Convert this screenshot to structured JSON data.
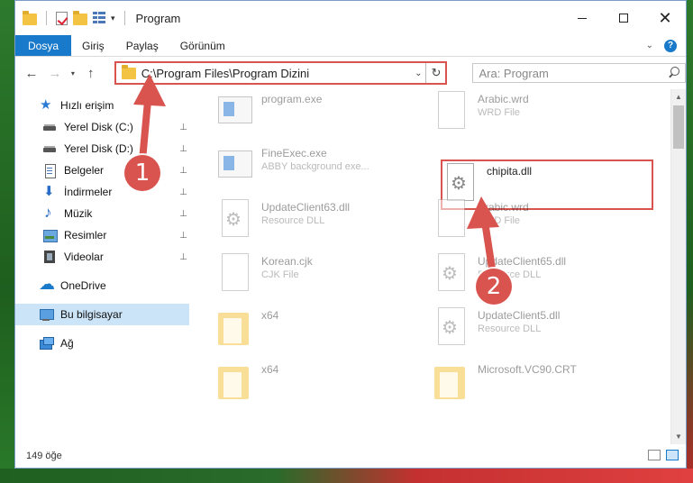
{
  "window": {
    "title": "Program",
    "minimize_label": "",
    "maximize_label": "",
    "close_label": "✕"
  },
  "ribbon": {
    "tabs": [
      "Dosya",
      "Giriş",
      "Paylaş",
      "Görünüm"
    ],
    "active_tab": "Dosya",
    "expand_label": "⌄",
    "help_label": "?"
  },
  "nav": {
    "back_label": "←",
    "forward_label": "→",
    "recent_label": "▾",
    "up_label": "↑",
    "address": "C:\\Program Files\\Program Dizini",
    "address_chevron": "⌄",
    "refresh_label": "↻",
    "search_placeholder": "Ara: Program"
  },
  "sidebar": {
    "items": [
      {
        "label": "Hızlı erişim",
        "icon": "star-icon"
      },
      {
        "label": "Yerel Disk (C:)",
        "icon": "drive-icon",
        "pinned": true
      },
      {
        "label": "Yerel Disk (D:)",
        "icon": "drive-icon",
        "pinned": true
      },
      {
        "label": "Belgeler",
        "icon": "document-icon",
        "pinned": true
      },
      {
        "label": "İndirmeler",
        "icon": "download-icon",
        "pinned": true
      },
      {
        "label": "Müzik",
        "icon": "music-icon",
        "pinned": true
      },
      {
        "label": "Resimler",
        "icon": "pictures-icon",
        "pinned": true
      },
      {
        "label": "Videolar",
        "icon": "videos-icon",
        "pinned": true
      },
      {
        "label": "OneDrive",
        "icon": "cloud-icon"
      },
      {
        "label": "Bu bilgisayar",
        "icon": "computer-icon",
        "selected": true
      },
      {
        "label": "Ağ",
        "icon": "network-icon"
      }
    ],
    "pin_glyph": "📌"
  },
  "files": [
    {
      "name": "program.exe",
      "type": "",
      "icon": "exe-icon"
    },
    {
      "name": "Arabic.wrd",
      "type": "WRD File",
      "icon": "doc-icon"
    },
    {
      "name": "FineExec.exe",
      "type": "ABBY background exe...",
      "icon": "exe-icon"
    },
    {
      "name": "chipita.dll",
      "type": "",
      "icon": "dll-icon",
      "highlighted": true
    },
    {
      "name": "UpdateClient63.dll",
      "type": "Resource DLL",
      "icon": "dll-icon"
    },
    {
      "name": "Arabic.wrd",
      "type": "WRD File",
      "icon": "doc-icon"
    },
    {
      "name": "Korean.cjk",
      "type": "CJK File",
      "icon": "doc-icon"
    },
    {
      "name": "UpdateClient65.dll",
      "type": "Resource DLL",
      "icon": "dll-icon"
    },
    {
      "name": "x64",
      "type": "",
      "icon": "folder-icon"
    },
    {
      "name": "UpdateClient5.dll",
      "type": "Resource DLL",
      "icon": "dll-icon"
    },
    {
      "name": "x64",
      "type": "",
      "icon": "folder-icon"
    },
    {
      "name": "Microsoft.VC90.CRT",
      "type": "",
      "icon": "folder-icon"
    }
  ],
  "status": {
    "count_text": "149 öğe"
  },
  "annotations": {
    "badge_1": "1",
    "badge_2": "2",
    "color": "#d9534f"
  }
}
